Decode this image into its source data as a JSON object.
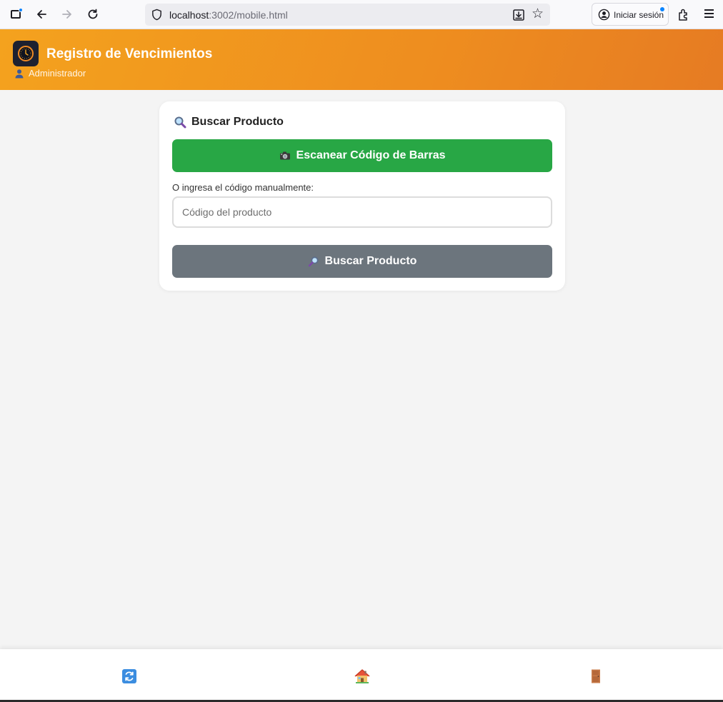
{
  "browser": {
    "url_host": "localhost",
    "url_path": ":3002/mobile.html",
    "signin_label": "Iniciar sesión",
    "icons": [
      "tab-overview-icon",
      "back-arrow-icon",
      "forward-arrow-icon",
      "reload-icon",
      "shield-icon",
      "save-page-icon",
      "bookmark-star-icon",
      "account-icon",
      "extensions-icon",
      "hamburger-menu-icon"
    ]
  },
  "header": {
    "title": "Registro de Vencimientos",
    "user": "Administrador",
    "background": "#ef8f1f",
    "icons": [
      "clock-logo-icon",
      "user-icon"
    ]
  },
  "search_card": {
    "title": "Buscar Producto",
    "scan_button": "Escanear Código de Barras",
    "manual_label": "O ingresa el código manualmente:",
    "code_placeholder": "Código del producto",
    "code_value": "",
    "search_button": "Buscar Producto",
    "colors": {
      "scan": "#28a745",
      "search": "#6c757d"
    },
    "icons": [
      "magnifier-icon",
      "camera-icon",
      "magnifier-right-icon"
    ]
  },
  "bottom_nav": {
    "items": [
      {
        "name": "refresh",
        "icon": "refresh-icon"
      },
      {
        "name": "home",
        "icon": "home-icon"
      },
      {
        "name": "logout",
        "icon": "door-icon"
      }
    ]
  }
}
